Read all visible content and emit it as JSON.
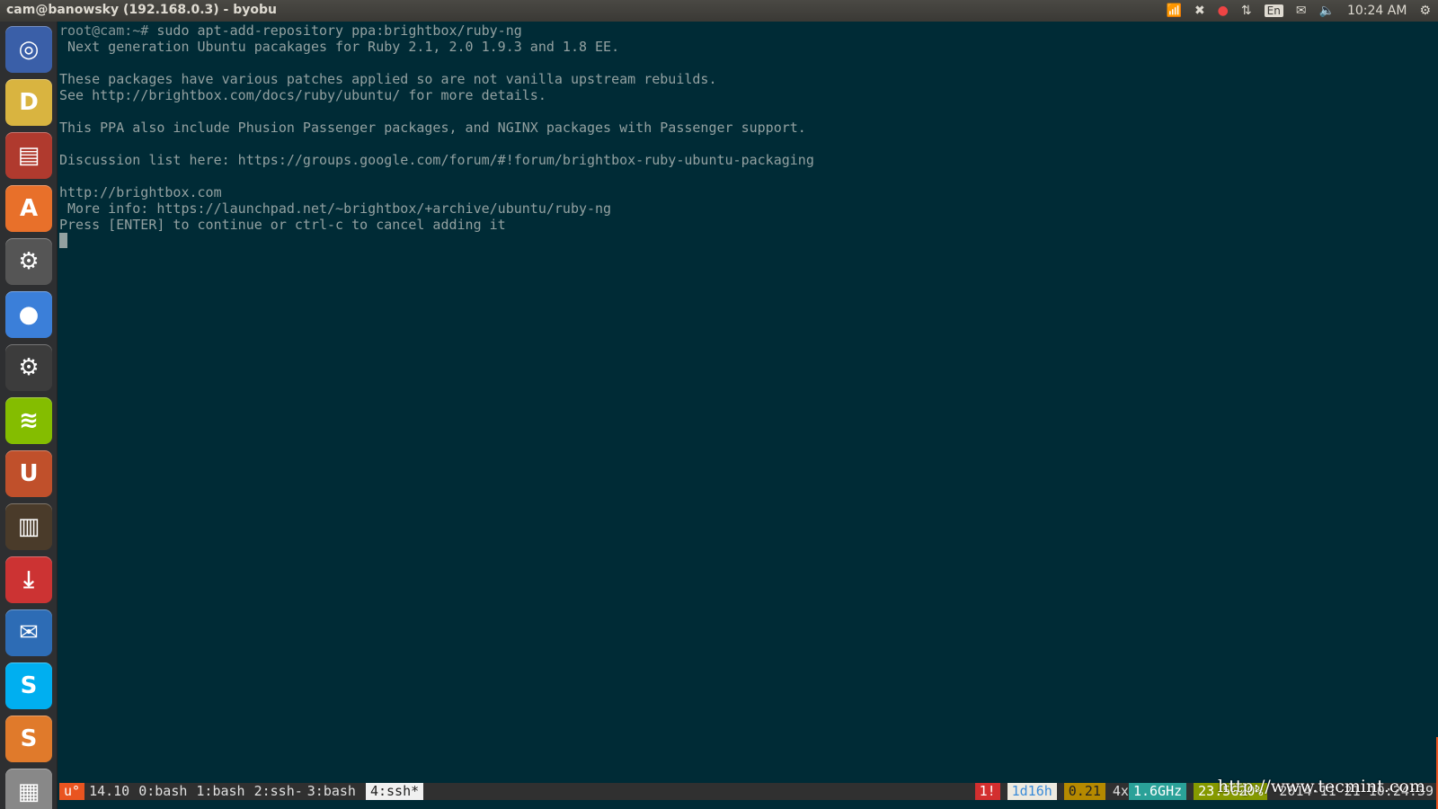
{
  "window": {
    "title": "cam@banowsky (192.168.0.3) - byobu"
  },
  "tray": {
    "keyboard": "En",
    "clock": "10:24 AM"
  },
  "launcher": {
    "items": [
      {
        "name": "ubuntu-dash",
        "color": "#3a5fa8",
        "glyph": "◎"
      },
      {
        "name": "pidgin",
        "color": "#d9b440",
        "glyph": "D"
      },
      {
        "name": "files",
        "color": "#b03a2e",
        "glyph": "▤"
      },
      {
        "name": "software-center",
        "color": "#e8702a",
        "glyph": "A"
      },
      {
        "name": "system-settings",
        "color": "#555",
        "glyph": "⚙"
      },
      {
        "name": "chrome",
        "color": "#3b7fd9",
        "glyph": "●"
      },
      {
        "name": "steam",
        "color": "#3c3c3c",
        "glyph": "⚙"
      },
      {
        "name": "spotify",
        "color": "#84bd00",
        "glyph": "≋"
      },
      {
        "name": "ubuntu-one",
        "color": "#c0502b",
        "glyph": "U"
      },
      {
        "name": "calibre",
        "color": "#4a3b2a",
        "glyph": "▥"
      },
      {
        "name": "update-manager",
        "color": "#c33",
        "glyph": "⤓"
      },
      {
        "name": "thunderbird",
        "color": "#2d6cb5",
        "glyph": "✉"
      },
      {
        "name": "skype",
        "color": "#00aff0",
        "glyph": "S"
      },
      {
        "name": "sublime-text",
        "color": "#e07a2b",
        "glyph": "S"
      },
      {
        "name": "workspaces",
        "color": "#888",
        "glyph": "▦"
      }
    ]
  },
  "terminal": {
    "prompt": "root@cam:~#",
    "command": " sudo apt-add-repository ppa:brightbox/ruby-ng",
    "lines": [
      " Next generation Ubuntu pacakages for Ruby 2.1, 2.0 1.9.3 and 1.8 EE.",
      "",
      "These packages have various patches applied so are not vanilla upstream rebuilds.",
      "See http://brightbox.com/docs/ruby/ubuntu/ for more details.",
      "",
      "This PPA also include Phusion Passenger packages, and NGINX packages with Passenger support.",
      "",
      "Discussion list here: https://groups.google.com/forum/#!forum/brightbox-ruby-ubuntu-packaging",
      "",
      "http://brightbox.com",
      " More info: https://launchpad.net/~brightbox/+archive/ubuntu/ruby-ng",
      "Press [ENTER] to continue or ctrl-c to cancel adding it"
    ]
  },
  "byobu": {
    "logo": "u°",
    "release": "14.10",
    "windows": [
      "0:bash",
      "1:bash",
      "2:ssh-",
      "3:bash"
    ],
    "active_window": "4:ssh*",
    "updates": "1!",
    "uptime": "1d16h",
    "load": "0.21",
    "cpu_count": "4x",
    "cpu_freq": "1.6GHz",
    "memory": "23.5G20%",
    "datetime": "2014-11-21 10:24:39"
  },
  "watermark": "http://www.tecmint.com"
}
